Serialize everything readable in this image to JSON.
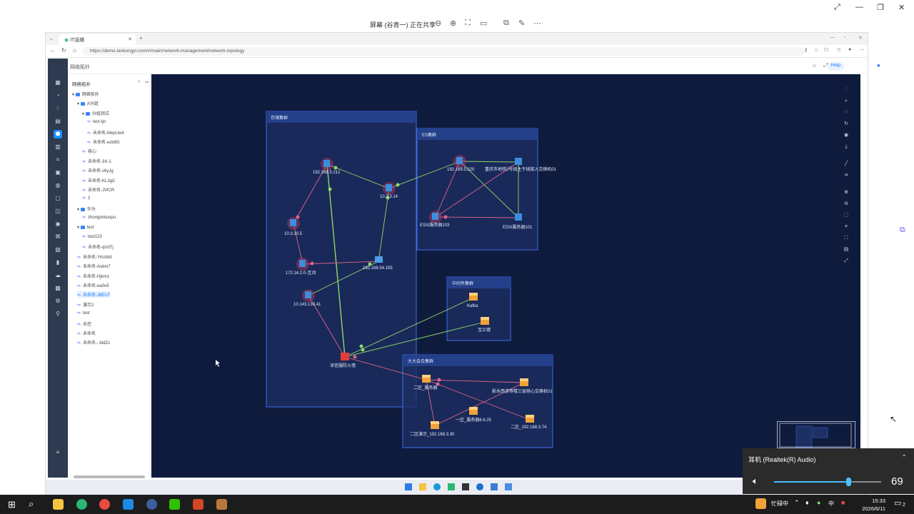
{
  "share_bar": {
    "title": "屏幕 (谷青一) 正在共享",
    "icons": [
      "zoom-out-icon",
      "zoom-in-icon",
      "fit-icon",
      "ratio-icon",
      "window-icon",
      "annotate-icon",
      "more-icon"
    ]
  },
  "browser": {
    "tab_title": "IT运维",
    "url": "https://demo.lankongyi.com/#/main/network-management/network-topology"
  },
  "app": {
    "breadcrumb": "网络拓扑",
    "help_label": "Help",
    "tree_title": "网络拓扑",
    "tree": [
      {
        "label": "网络拓扑",
        "type": "folder",
        "level": 0
      },
      {
        "label": "A分组",
        "type": "folder",
        "level": 1
      },
      {
        "label": "分组测试",
        "type": "folder",
        "level": 2
      },
      {
        "label": "test-tjn",
        "type": "link",
        "level": 3
      },
      {
        "label": "未命名-MepUw4",
        "type": "link",
        "level": 3
      },
      {
        "label": "未命名-ezb8G",
        "type": "link",
        "level": 3
      },
      {
        "label": "核心",
        "type": "link",
        "level": 2
      },
      {
        "label": "未命名-3X-1",
        "type": "link",
        "level": 2
      },
      {
        "label": "未命名-v6yJg",
        "type": "link",
        "level": 2
      },
      {
        "label": "未命名-KL3gC",
        "type": "link",
        "level": 2
      },
      {
        "label": "未命名-JVlCR",
        "type": "link",
        "level": 2
      },
      {
        "label": "2",
        "type": "link",
        "level": 2
      },
      {
        "label": "华为",
        "type": "folder",
        "level": 1
      },
      {
        "label": "zhongxintuopu",
        "type": "link",
        "level": 2
      },
      {
        "label": "test",
        "type": "folder",
        "level": 1
      },
      {
        "label": "test123",
        "type": "link",
        "level": 2
      },
      {
        "label": "未命名-qVdTj",
        "type": "link",
        "level": 2
      },
      {
        "label": "未命名-YKoWd",
        "type": "link",
        "level": 1
      },
      {
        "label": "未命名-Aokm7",
        "type": "link",
        "level": 1
      },
      {
        "label": "未命名-Hjkm1",
        "type": "link",
        "level": 1
      },
      {
        "label": "未命名-ea5o5",
        "type": "link",
        "level": 1
      },
      {
        "label": "未命名-J8EUT",
        "type": "link",
        "level": 1,
        "selected": true
      },
      {
        "label": "演示2",
        "type": "link",
        "level": 1
      },
      {
        "label": "test",
        "type": "link",
        "level": 1
      },
      {
        "label": "未控",
        "type": "link",
        "level": 1
      },
      {
        "label": "未命名",
        "type": "link",
        "level": 1
      },
      {
        "label": "未命名-..bldZs",
        "type": "link",
        "level": 1
      }
    ]
  },
  "topology": {
    "groups": [
      "存储集群",
      "ES集群",
      "中间件集群",
      "大大会合集群"
    ],
    "nodes": [
      "192.168.5.212",
      "10.3.10.5",
      "172.16.2.0-互动",
      "192.168.54.155",
      "10.143.130.41",
      "10.2.3.14",
      "192.168.5.220",
      "重庆市地铁2号线主干线接入交换机01",
      "ESXi服务器103",
      "ESXi服务器101",
      "Kafka",
      "宝兰德",
      "深信服防火墙",
      "二区_服务器",
      "影水西游等楼三层核心交换机01",
      "一区_服务器6.6.25",
      "二区演示_192.168.3.30",
      "二区_192.168.3.74"
    ]
  },
  "volume": {
    "title": "耳机 (Realtek(R) Audio)",
    "level": 69
  },
  "taskbar": {
    "ime_label": "忙碌中",
    "ime_lang": "中",
    "time": "15:33",
    "date": "2026/6/11",
    "notification_count": "2"
  },
  "colors": {
    "canvas_bg": "#0f1b3d",
    "group_fill": "#1d2f63",
    "group_border": "#3e6ef0",
    "link_green": "#8fd86a",
    "link_red": "#e0648a",
    "accent": "#1890ff"
  }
}
